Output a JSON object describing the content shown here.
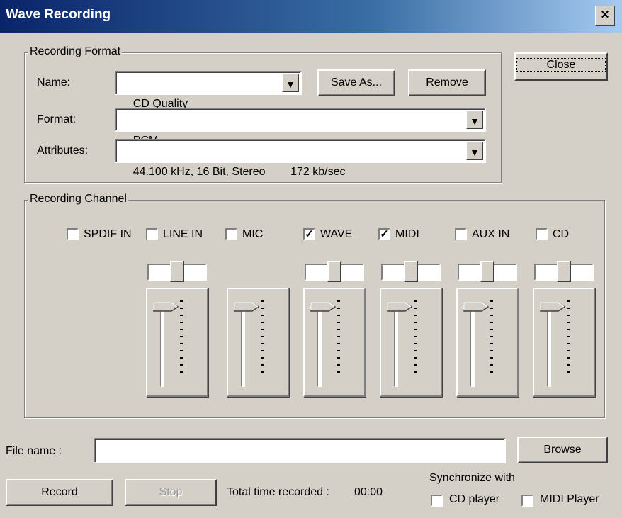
{
  "window": {
    "title": "Wave Recording",
    "close_glyph": "×"
  },
  "close_button": {
    "label": "Close"
  },
  "recording_format": {
    "legend": "Recording Format",
    "name_label": "Name:",
    "name_value": "CD Quality",
    "save_as_label": "Save As...",
    "remove_label": "Remove",
    "format_label": "Format:",
    "format_value": "PCM",
    "attributes_label": "Attributes:",
    "attributes_value": "44.100 kHz, 16 Bit, Stereo        172 kb/sec",
    "dropdown_glyph": "▼"
  },
  "recording_channel": {
    "legend": "Recording Channel",
    "channels": [
      {
        "label": "SPDIF IN",
        "checked": false
      },
      {
        "label": "LINE IN",
        "checked": false
      },
      {
        "label": "MIC",
        "checked": false
      },
      {
        "label": "WAVE",
        "checked": true
      },
      {
        "label": "MIDI",
        "checked": true
      },
      {
        "label": "AUX IN",
        "checked": false
      },
      {
        "label": "CD",
        "checked": false
      }
    ]
  },
  "file": {
    "label": "File name :",
    "value": "",
    "browse_label": "Browse"
  },
  "controls": {
    "record_label": "Record",
    "stop_label": "Stop",
    "total_time_label": "Total time recorded :",
    "total_time_value": "00:00"
  },
  "sync": {
    "label": "Synchronize with",
    "cd_player_label": "CD player",
    "cd_player_checked": false,
    "midi_player_label": "MIDI Player",
    "midi_player_checked": false
  },
  "check_glyph": "✓"
}
